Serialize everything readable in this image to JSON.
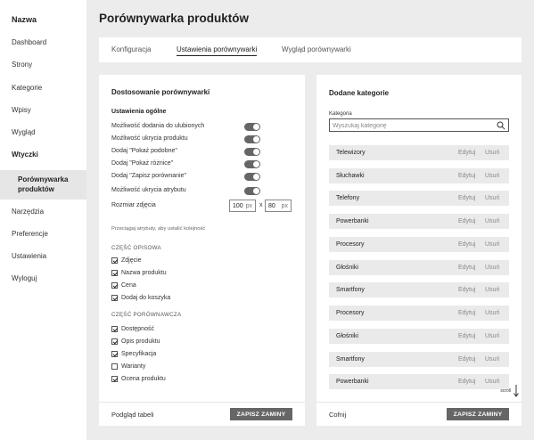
{
  "sidebar": {
    "brand": "Nazwa",
    "items": [
      {
        "label": "Dashboard"
      },
      {
        "label": "Strony"
      },
      {
        "label": "Kategorie"
      },
      {
        "label": "Wpisy"
      },
      {
        "label": "Wygląd"
      },
      {
        "label": "Wtyczki"
      },
      {
        "label": "Porównywarka produktów"
      },
      {
        "label": "Narzędzia"
      },
      {
        "label": "Preferencje"
      },
      {
        "label": "Ustawienia"
      },
      {
        "label": "Wyloguj"
      }
    ]
  },
  "header": {
    "title": "Porównywarka produktów"
  },
  "tabs": [
    {
      "label": "Konfiguracja"
    },
    {
      "label": "Ustawienia porównywarki"
    },
    {
      "label": "Wygląd porównywarki"
    }
  ],
  "left_card": {
    "title": "Dostosowanie porównywarki",
    "general_section": "Ustawienia ogólne",
    "settings": [
      {
        "label": "Możliwość dodania do ulubionych",
        "enabled": true
      },
      {
        "label": "Możliwość ukrycia produktu",
        "enabled": true
      },
      {
        "label": "Dodaj \"Pokaż podobne\"",
        "enabled": true
      },
      {
        "label": "Dodaj \"Pokaż różnice\"",
        "enabled": true
      },
      {
        "label": "Dodaj \"Zapisz porównanie\"",
        "enabled": true
      },
      {
        "label": "Możliwość ukrycia atrybutu",
        "enabled": true
      }
    ],
    "size_label": "Rozmiar zdjęcia",
    "size_width": "100",
    "size_height": "80",
    "size_unit": "px",
    "size_separator": "x",
    "hint": "Przeciągaj atrybuty, aby ustalić kolejność",
    "opis_group_title": "CZĘŚĆ OPISOWA",
    "opis_items": [
      {
        "label": "Zdjęcie",
        "checked": true
      },
      {
        "label": "Nazwa produktu",
        "checked": true
      },
      {
        "label": "Cena",
        "checked": true
      },
      {
        "label": "Dodaj do koszyka",
        "checked": true
      }
    ],
    "porown_group_title": "CZĘŚĆ PORÓWNAWCZA",
    "porown_items": [
      {
        "label": "Dostępność",
        "checked": true
      },
      {
        "label": "Opis produktu",
        "checked": true
      },
      {
        "label": "Specyfikacja",
        "checked": true
      },
      {
        "label": "Warianty",
        "checked": false
      },
      {
        "label": "Ocena produktu",
        "checked": true
      }
    ],
    "footer_link": "Podgląd tabeli",
    "save_label": "ZAPISZ ZAMINY"
  },
  "right_card": {
    "title": "Dodane kategorie",
    "field_label": "Kategoria",
    "search_placeholder": "Wyszukaj kategorię",
    "edit_label": "Edytuj",
    "delete_label": "Usuń",
    "categories": [
      {
        "name": "Telewizory"
      },
      {
        "name": "Słuchawki"
      },
      {
        "name": "Telefony"
      },
      {
        "name": "Powerbanki"
      },
      {
        "name": "Procesory"
      },
      {
        "name": "Głośniki"
      },
      {
        "name": "Smartfony"
      },
      {
        "name": "Procesory"
      },
      {
        "name": "Głośniki"
      },
      {
        "name": "Smartfony"
      },
      {
        "name": "Powerbanki"
      }
    ],
    "scroll_hint": "scroll",
    "cancel_label": "Cofnij",
    "save_label": "ZAPISZ ZAMINY"
  }
}
